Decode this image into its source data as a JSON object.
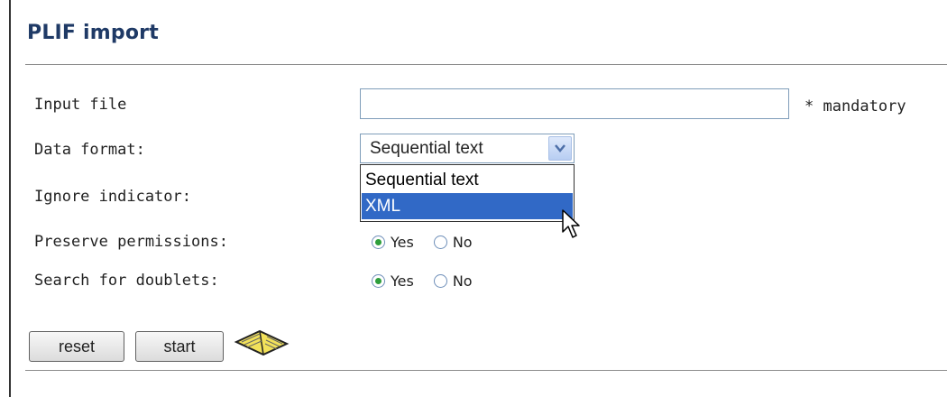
{
  "title": "PLIF import",
  "form": {
    "input_file": {
      "label": "Input file",
      "value": "",
      "hint": "* mandatory"
    },
    "data_format": {
      "label": "Data format:",
      "value": "Sequential text",
      "options": [
        "Sequential text",
        "XML"
      ],
      "highlighted": "XML",
      "arrow_icon": "chevron-down-icon"
    },
    "ignore_indicator": {
      "label": "Ignore indicator:"
    },
    "preserve_permissions": {
      "label": "Preserve permissions:",
      "yes": "Yes",
      "no": "No",
      "selected": "Yes"
    },
    "search_doublets": {
      "label": "Search for doublets:",
      "yes": "Yes",
      "no": "No",
      "selected": "Yes"
    }
  },
  "buttons": {
    "reset": "reset",
    "start": "start",
    "help_icon": "book-icon"
  },
  "colors": {
    "title": "#1f3a66",
    "highlight": "#3169c6",
    "radio_dot": "#2e9e3b"
  }
}
